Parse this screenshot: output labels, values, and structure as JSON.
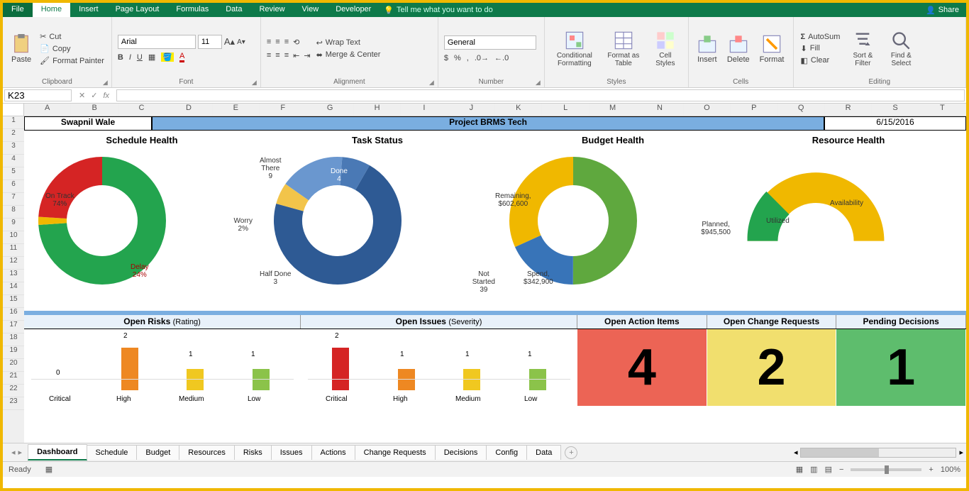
{
  "menu": {
    "tabs": [
      "File",
      "Home",
      "Insert",
      "Page Layout",
      "Formulas",
      "Data",
      "Review",
      "View",
      "Developer"
    ],
    "tellme": "Tell me what you want to do",
    "share": "Share",
    "active": "Home"
  },
  "ribbon": {
    "clipboard": {
      "label": "Clipboard",
      "paste": "Paste",
      "cut": "Cut",
      "copy": "Copy",
      "painter": "Format Painter"
    },
    "font": {
      "label": "Font",
      "name": "Arial",
      "size": "11"
    },
    "alignment": {
      "label": "Alignment",
      "wrap": "Wrap Text",
      "merge": "Merge & Center"
    },
    "number": {
      "label": "Number",
      "format": "General"
    },
    "styles": {
      "label": "Styles",
      "cond": "Conditional Formatting",
      "table": "Format as Table",
      "cell": "Cell Styles"
    },
    "cells": {
      "label": "Cells",
      "insert": "Insert",
      "delete": "Delete",
      "format": "Format"
    },
    "editing": {
      "label": "Editing",
      "autosum": "AutoSum",
      "fill": "Fill",
      "clear": "Clear",
      "sort": "Sort & Filter",
      "find": "Find & Select"
    }
  },
  "namebox": "K23",
  "columns": [
    "A",
    "B",
    "C",
    "D",
    "E",
    "F",
    "G",
    "H",
    "I",
    "J",
    "K",
    "L",
    "M",
    "N",
    "O",
    "P",
    "Q",
    "R",
    "S",
    "T"
  ],
  "rows": [
    "1",
    "2",
    "3",
    "4",
    "5",
    "6",
    "7",
    "8",
    "9",
    "10",
    "11",
    "12",
    "13",
    "14",
    "15",
    "16",
    "17",
    "18",
    "19",
    "20",
    "21",
    "22",
    "23"
  ],
  "dashboard": {
    "author": "Swapnil Wale",
    "project": "Project BRMS Tech",
    "date": "6/15/2016",
    "sections": {
      "schedule": "Schedule Health",
      "task": "Task Status",
      "budget": "Budget Health",
      "resource": "Resource Health"
    },
    "schedule_labels": {
      "ontrack": "On Track\n74%",
      "worry": "Worry\n2%",
      "delay": "Delay\n24%"
    },
    "task_labels": {
      "almost": "Almost\nThere\n9",
      "done": "Done\n4",
      "half": "Half Done\n3",
      "notstarted": "Not\nStarted\n39"
    },
    "budget_labels": {
      "remaining": "Remaining,\n$602,600",
      "planned": "Planned,\n$945,500",
      "spend": "Spend,\n$342,900"
    },
    "resource_labels": {
      "utilized": "Utilized",
      "availability": "Availability"
    },
    "sub_risks": "Open Risks",
    "sub_risks_suffix": "(Rating)",
    "sub_issues": "Open Issues",
    "sub_issues_suffix": "(Severity)",
    "sub_action": "Open Action Items",
    "sub_change": "Open Change Requests",
    "sub_pending": "Pending Decisions",
    "action_count": "4",
    "change_count": "2",
    "pending_count": "1",
    "risk_categories": [
      "Critical",
      "High",
      "Medium",
      "Low"
    ],
    "risk_values": [
      "0",
      "2",
      "1",
      "1"
    ],
    "issue_categories": [
      "Critical",
      "High",
      "Medium",
      "Low"
    ],
    "issue_values": [
      "2",
      "1",
      "1",
      "1"
    ]
  },
  "chart_data": [
    {
      "type": "pie",
      "title": "Schedule Health",
      "series": [
        {
          "name": "On Track",
          "value": 74
        },
        {
          "name": "Worry",
          "value": 2
        },
        {
          "name": "Delay",
          "value": 24
        }
      ]
    },
    {
      "type": "pie",
      "title": "Task Status",
      "series": [
        {
          "name": "Almost There",
          "value": 9
        },
        {
          "name": "Done",
          "value": 4
        },
        {
          "name": "Half Done",
          "value": 3
        },
        {
          "name": "Not Started",
          "value": 39
        }
      ]
    },
    {
      "type": "pie",
      "title": "Budget Health",
      "series": [
        {
          "name": "Planned",
          "value": 945500
        },
        {
          "name": "Spend",
          "value": 342900
        },
        {
          "name": "Remaining",
          "value": 602600
        }
      ]
    },
    {
      "type": "pie",
      "title": "Resource Health",
      "series": [
        {
          "name": "Utilized",
          "value": 20
        },
        {
          "name": "Availability",
          "value": 80
        }
      ]
    },
    {
      "type": "bar",
      "title": "Open Risks (Rating)",
      "categories": [
        "Critical",
        "High",
        "Medium",
        "Low"
      ],
      "values": [
        0,
        2,
        1,
        1
      ]
    },
    {
      "type": "bar",
      "title": "Open Issues (Severity)",
      "categories": [
        "Critical",
        "High",
        "Medium",
        "Low"
      ],
      "values": [
        2,
        1,
        1,
        1
      ]
    }
  ],
  "sheet_tabs": [
    "Dashboard",
    "Schedule",
    "Budget",
    "Resources",
    "Risks",
    "Issues",
    "Actions",
    "Change Requests",
    "Decisions",
    "Config",
    "Data"
  ],
  "status": {
    "ready": "Ready",
    "zoom": "100%"
  }
}
